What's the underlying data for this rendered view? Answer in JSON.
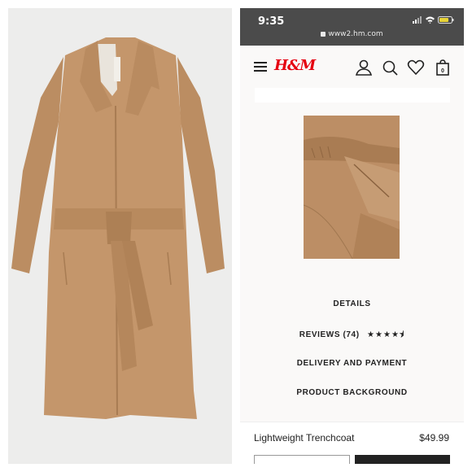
{
  "status_bar": {
    "time": "9:35",
    "url": "www2.hm.com",
    "icons": [
      "signal-icon",
      "wifi-icon",
      "battery-icon"
    ]
  },
  "nav": {
    "logo": "H&M",
    "icons": [
      "menu-icon",
      "account-icon",
      "search-icon",
      "heart-icon",
      "bag-icon"
    ],
    "bag_count": "0"
  },
  "product_image": {
    "subject": "camel trench coat with tie belt"
  },
  "menu": {
    "details": "DETAILS",
    "reviews": "REVIEWS (74)",
    "reviews_rating_stars": 4.5,
    "delivery": "DELIVERY AND PAYMENT",
    "background": "PRODUCT BACKGROUND"
  },
  "bottom_bar": {
    "product_name": "Lightweight Trenchcoat",
    "price": "$49.99"
  },
  "colors": {
    "brand_red": "#e50010",
    "coat": "#c4966b",
    "status_bar": "#4b4b4b"
  }
}
